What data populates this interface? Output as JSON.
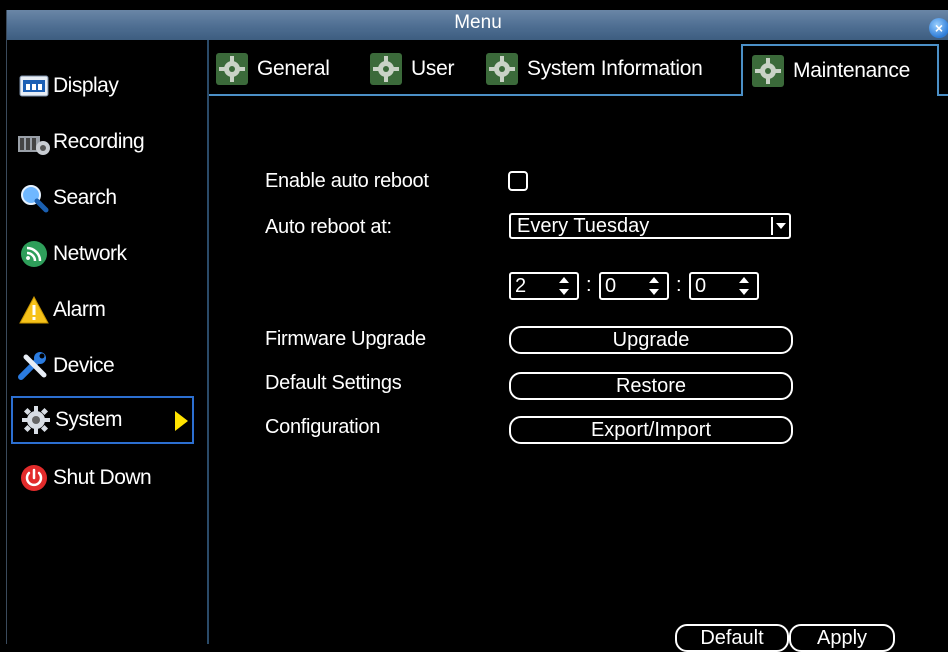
{
  "window": {
    "title": "Menu",
    "close_glyph": "×"
  },
  "sidebar": {
    "items": [
      {
        "label": "Display",
        "icon": "display-icon"
      },
      {
        "label": "Recording",
        "icon": "recording-icon"
      },
      {
        "label": "Search",
        "icon": "search-icon"
      },
      {
        "label": "Network",
        "icon": "network-icon"
      },
      {
        "label": "Alarm",
        "icon": "alarm-icon"
      },
      {
        "label": "Device",
        "icon": "device-icon"
      },
      {
        "label": "System",
        "icon": "system-gear-icon",
        "active": true
      },
      {
        "label": "Shut Down",
        "icon": "power-icon"
      }
    ]
  },
  "tabs": [
    {
      "label": "General"
    },
    {
      "label": "User"
    },
    {
      "label": "System Information"
    },
    {
      "label": "Maintenance",
      "active": true
    }
  ],
  "maintenance": {
    "enable_auto_reboot_label": "Enable auto reboot",
    "enable_auto_reboot_checked": false,
    "auto_reboot_at_label": "Auto reboot at:",
    "schedule_value": "Every Tuesday",
    "hour": "2",
    "minute": "0",
    "second": "0",
    "time_sep": ":",
    "firmware_label": "Firmware Upgrade",
    "firmware_button": "Upgrade",
    "default_label": "Default Settings",
    "default_button": "Restore",
    "config_label": "Configuration",
    "config_button": "Export/Import"
  },
  "footer": {
    "default_button": "Default",
    "apply_button": "Apply"
  },
  "colors": {
    "accent_blue": "#4b8fc6",
    "active_border": "#2c6fd1",
    "arrow_yellow": "#ffe300"
  }
}
